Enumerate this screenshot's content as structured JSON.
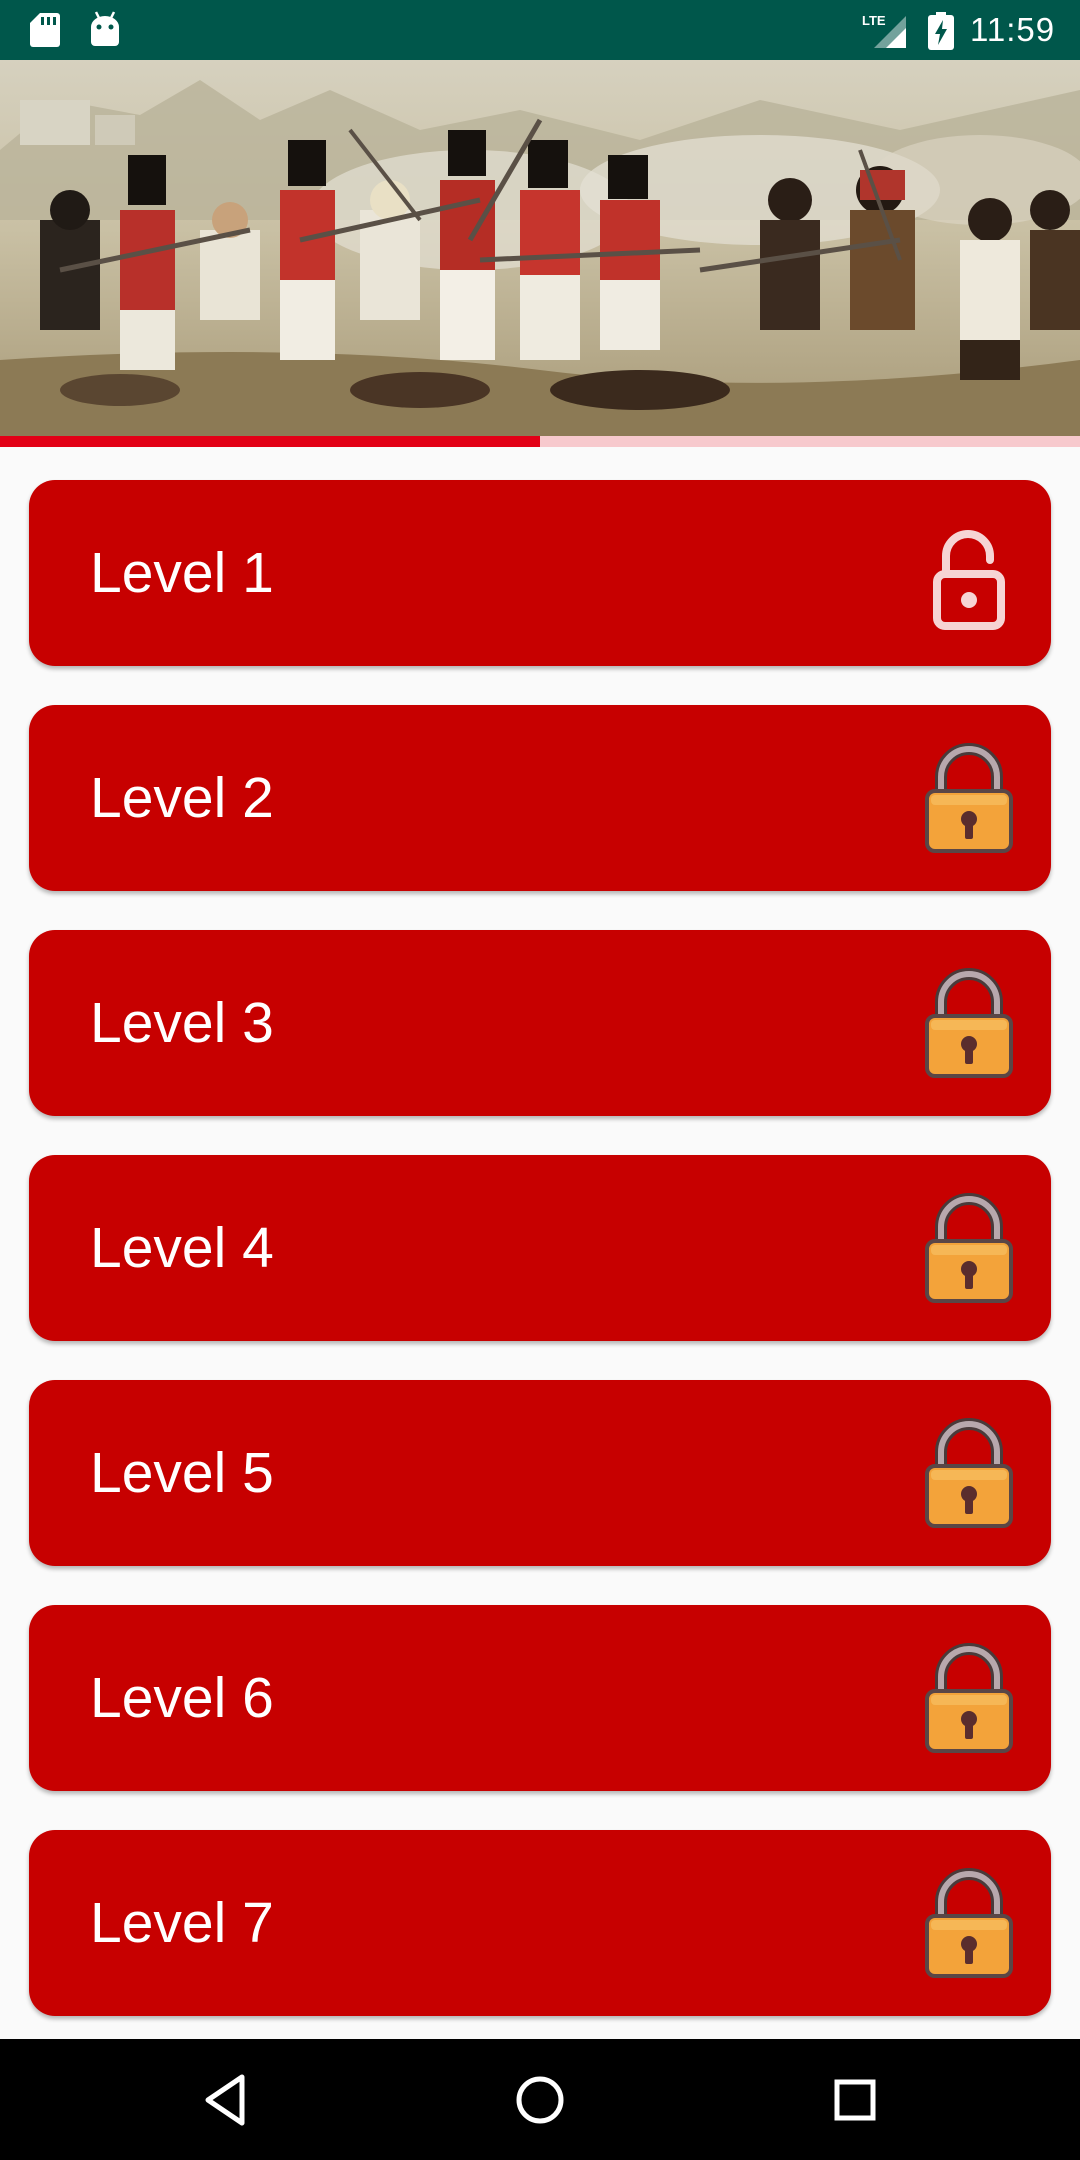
{
  "status_bar": {
    "time": "11:59",
    "network": "LTE",
    "icons": [
      "sd-card-icon",
      "android-icon",
      "lte-signal-icon",
      "battery-charging-icon"
    ]
  },
  "header": {
    "image": "battle-painting-icon"
  },
  "progress": {
    "fraction": 0.5,
    "fill_color": "#e20016",
    "track_color": "#f7c9cd"
  },
  "theme": {
    "card_color": "#c70000",
    "status_bar_color": "#00574b"
  },
  "levels": [
    {
      "label": "Level 1",
      "icon": "unlocked-padlock-icon",
      "locked": false
    },
    {
      "label": "Level 2",
      "icon": "locked-padlock-icon",
      "locked": true
    },
    {
      "label": "Level 3",
      "icon": "locked-padlock-icon",
      "locked": true
    },
    {
      "label": "Level 4",
      "icon": "locked-padlock-icon",
      "locked": true
    },
    {
      "label": "Level 5",
      "icon": "locked-padlock-icon",
      "locked": true
    },
    {
      "label": "Level 6",
      "icon": "locked-padlock-icon",
      "locked": true
    },
    {
      "label": "Level 7",
      "icon": "locked-padlock-icon",
      "locked": true
    }
  ],
  "nav_bar": {
    "buttons": [
      "back-icon",
      "home-icon",
      "recents-icon"
    ]
  }
}
